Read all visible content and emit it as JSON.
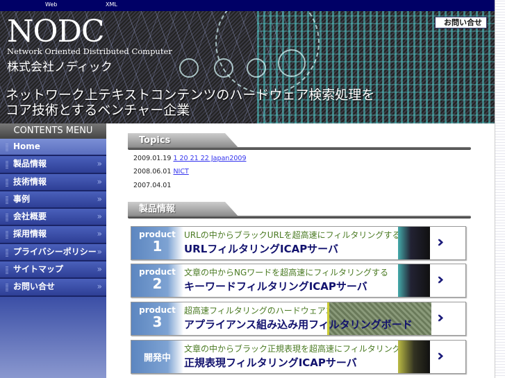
{
  "topbar": {
    "links": [
      "Web",
      "XML"
    ]
  },
  "header": {
    "logo": "NODC",
    "logo_sub": "Network Oriented Distributed Computer",
    "company": "株式会社ノディック",
    "tagline_1": "ネットワーク上テキストコンテンツのハードウェア検索処理を",
    "tagline_2": "コア技術とするベンチャー企業",
    "contact_button": "お問い合せ"
  },
  "sidebar": {
    "title": "CONTENTS MENU",
    "items": [
      {
        "label": "Home"
      },
      {
        "label": "製品情報"
      },
      {
        "label": "技術情報"
      },
      {
        "label": "事例"
      },
      {
        "label": "会社概要"
      },
      {
        "label": "採用情報"
      },
      {
        "label": "プライバシーポリシー"
      },
      {
        "label": "サイトマップ"
      },
      {
        "label": "お問い合せ"
      }
    ],
    "chevron": "»"
  },
  "topics": {
    "title": "Topics",
    "items": [
      {
        "date": "2009.01.19",
        "link": "1 20 21 22 Japan2009"
      },
      {
        "date": "2008.06.01",
        "link": "NICT"
      },
      {
        "date": "2007.04.01",
        "link": ""
      }
    ]
  },
  "products": {
    "title": "製品情報",
    "items": [
      {
        "badge_1": "product",
        "badge_2": "1",
        "subtitle": "URLの中からブラックURLを超高速にフィルタリングする",
        "name": "URLフィルタリングICAPサーバ"
      },
      {
        "badge_1": "product",
        "badge_2": "2",
        "subtitle": "文章の中からNGワードを超高速にフィルタリングする",
        "name": "キーワードフィルタリングICAPサーバ"
      },
      {
        "badge_1": "product",
        "badge_2": "3",
        "subtitle": "超高速フィルタリングのハードウェアエンジン",
        "name": "アプライアンス組み込み用フィルタリングボード"
      },
      {
        "badge_1": "開発中",
        "badge_2": "",
        "subtitle": "文章の中からブラック正規表現を超高速にフィルタリングする",
        "name": "正規表現フィルタリングICAPサーバ"
      }
    ],
    "arrow": "›››"
  }
}
